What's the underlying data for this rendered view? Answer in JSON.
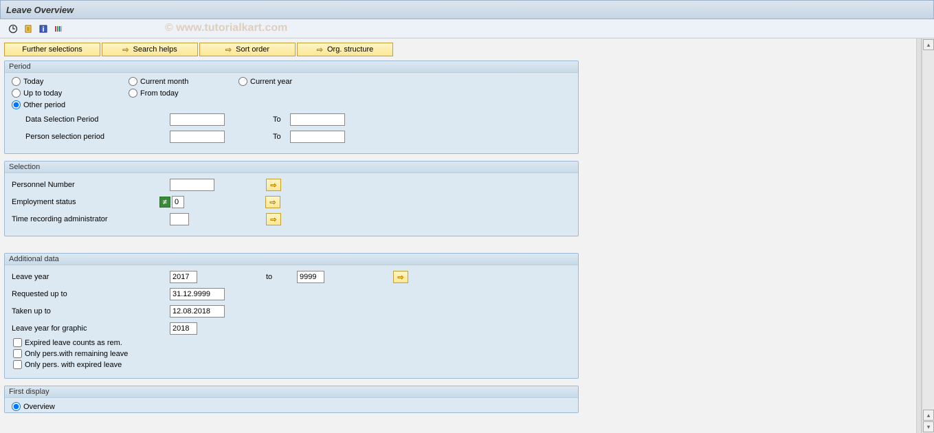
{
  "header": {
    "title": "Leave Overview"
  },
  "watermark": "© www.tutorialkart.com",
  "toolbar": {
    "icons": [
      "execute",
      "variant",
      "info",
      "settings"
    ]
  },
  "buttons": {
    "further_selections": "Further selections",
    "search_helps": "Search helps",
    "sort_order": "Sort order",
    "org_structure": "Org. structure"
  },
  "period": {
    "legend": "Period",
    "today": "Today",
    "current_month": "Current month",
    "current_year": "Current year",
    "up_to_today": "Up to today",
    "from_today": "From today",
    "other_period": "Other period",
    "data_sel_period": "Data Selection Period",
    "person_sel_period": "Person selection period",
    "to": "To",
    "data_from": "",
    "data_to": "",
    "person_from": "",
    "person_to": ""
  },
  "selection": {
    "legend": "Selection",
    "personnel_number": "Personnel Number",
    "employment_status": "Employment status",
    "time_rec_admin": "Time recording administrator",
    "pernr_val": "",
    "empstat_val": "0",
    "timeadmin_val": ""
  },
  "additional": {
    "legend": "Additional data",
    "leave_year": "Leave year",
    "to": "to",
    "requested_up_to": "Requested up to",
    "taken_up_to": "Taken up to",
    "leave_year_graphic": "Leave year for graphic",
    "expired_leave": "Expired leave counts as rem.",
    "only_remaining": "Only pers.with remaining leave",
    "only_expired": "Only pers. with expired leave",
    "leave_year_from": "2017",
    "leave_year_to": "9999",
    "requested_val": "31.12.9999",
    "taken_val": "12.08.2018",
    "graphic_val": "2018"
  },
  "first_display": {
    "legend": "First display",
    "overview": "Overview"
  }
}
